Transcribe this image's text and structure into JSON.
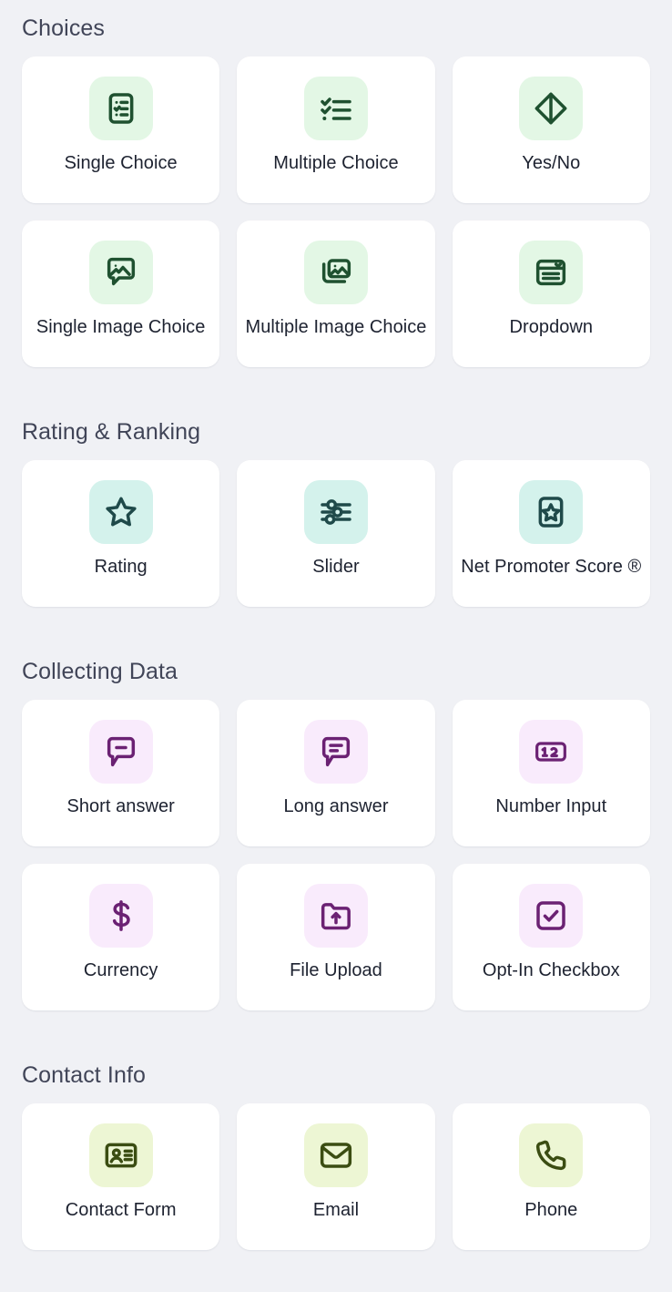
{
  "palette": {
    "page_bg": "#f0f1f5",
    "card_bg": "#ffffff",
    "heading_color": "#414558",
    "label_color": "#1d2230",
    "green_tile_bg": "#e3f7e5",
    "green_icon": "#1f5130",
    "mint_tile_bg": "#d4f2ec",
    "mint_icon": "#1f4a4a",
    "purple_tile_bg": "#f9ebfc",
    "purple_icon": "#6b2173",
    "lime_tile_bg": "#edf6d4",
    "lime_icon": "#3b4d12"
  },
  "sections": [
    {
      "title": "Choices",
      "theme": "green",
      "items": [
        {
          "label": "Single Choice",
          "icon": "clipboard-list-icon"
        },
        {
          "label": "Multiple Choice",
          "icon": "checklist-icon"
        },
        {
          "label": "Yes/No",
          "icon": "diamond-split-icon"
        },
        {
          "label": "Single Image Choice",
          "icon": "image-bubble-icon"
        },
        {
          "label": "Multiple Image Choice",
          "icon": "images-stack-icon"
        },
        {
          "label": "Dropdown",
          "icon": "dropdown-panel-icon"
        }
      ]
    },
    {
      "title": "Rating & Ranking",
      "theme": "mint",
      "items": [
        {
          "label": "Rating",
          "icon": "star-icon"
        },
        {
          "label": "Slider",
          "icon": "sliders-icon"
        },
        {
          "label": "Net Promoter Score ®",
          "icon": "star-card-icon"
        }
      ]
    },
    {
      "title": "Collecting Data",
      "theme": "purple",
      "items": [
        {
          "label": "Short answer",
          "icon": "bubble-dash-icon"
        },
        {
          "label": "Long answer",
          "icon": "bubble-lines-icon"
        },
        {
          "label": "Number Input",
          "icon": "number-box-icon"
        },
        {
          "label": "Currency",
          "icon": "dollar-icon"
        },
        {
          "label": "File Upload",
          "icon": "folder-upload-icon"
        },
        {
          "label": "Opt-In Checkbox",
          "icon": "checkbox-check-icon"
        }
      ]
    },
    {
      "title": "Contact Info",
      "theme": "lime",
      "items": [
        {
          "label": "Contact Form",
          "icon": "contact-card-icon"
        },
        {
          "label": "Email",
          "icon": "envelope-icon"
        },
        {
          "label": "Phone",
          "icon": "phone-icon"
        }
      ]
    }
  ]
}
